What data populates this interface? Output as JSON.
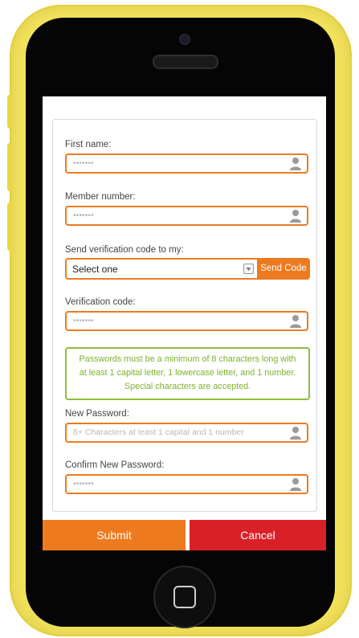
{
  "form": {
    "first_name": {
      "label": "First name:",
      "placeholder": "•••••••",
      "icon": "user-icon"
    },
    "member_number": {
      "label": "Member number:",
      "placeholder": "•••••••",
      "icon": "user-icon"
    },
    "send_code": {
      "label": "Send verification code to my:",
      "selected": "Select one",
      "button_label": "Send Code"
    },
    "verification_code": {
      "label": "Verification code:",
      "placeholder": "•••••••",
      "icon": "user-icon"
    },
    "password_notice": "Passwords must be a minimum of 8 characters long with at least 1 capital letter, 1 lowercase letter, and 1 number. Special characters are accepted.",
    "new_password": {
      "label": "New Password:",
      "placeholder": "8+ Characters at least 1 capital and 1 number",
      "icon": "user-icon"
    },
    "confirm_password": {
      "label": "Confirm New Password:",
      "placeholder": "•••••••",
      "icon": "user-icon"
    }
  },
  "actions": {
    "submit_label": "Submit",
    "cancel_label": "Cancel"
  },
  "colors": {
    "accent": "#ee7a1f",
    "cancel": "#d92027",
    "notice": "#7cb32b",
    "phone_body": "#f2e15a"
  }
}
